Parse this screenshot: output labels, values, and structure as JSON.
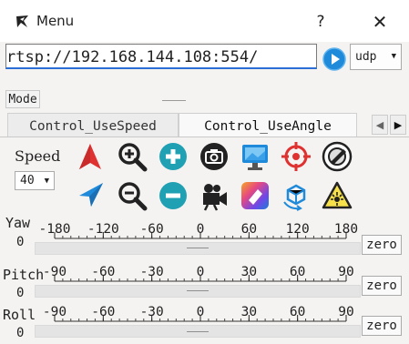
{
  "window": {
    "title": "Menu",
    "help_label": "?",
    "close_label": "✕"
  },
  "stream": {
    "url": "rtsp://192.168.144.108:554/",
    "protocol": "udp"
  },
  "mode_button": "Mode",
  "tabs": [
    {
      "label": "Control_UseSpeed",
      "active": false
    },
    {
      "label": "Control_UseAngle",
      "active": true
    }
  ],
  "speed": {
    "label": "Speed",
    "value": "40"
  },
  "toolbar": {
    "row1": [
      "arrow-up-icon",
      "zoom-in-icon",
      "add-icon",
      "camera-icon",
      "monitor-icon",
      "target-icon",
      "photo-lens-icon"
    ],
    "row2": [
      "navigate-icon",
      "zoom-out-icon",
      "remove-icon",
      "video-camera-icon",
      "color-fill-icon",
      "rotate-3d-icon",
      "laser-warning-icon"
    ]
  },
  "colors": {
    "accent_red": "#e03131",
    "accent_blue": "#1f8ad9",
    "teal": "#20a0b3",
    "dark": "#222222"
  },
  "axes": [
    {
      "name": "Yaw",
      "value": "0",
      "ticks": [
        "-180",
        "-120",
        "-60",
        "0",
        "60",
        "120",
        "180"
      ],
      "zero_label": "zero"
    },
    {
      "name": "Pitch",
      "value": "0",
      "ticks": [
        "-90",
        "-60",
        "-30",
        "0",
        "30",
        "60",
        "90"
      ],
      "zero_label": "zero"
    },
    {
      "name": "Roll",
      "value": "0",
      "ticks": [
        "-90",
        "-60",
        "-30",
        "0",
        "30",
        "60",
        "90"
      ],
      "zero_label": "zero"
    }
  ]
}
